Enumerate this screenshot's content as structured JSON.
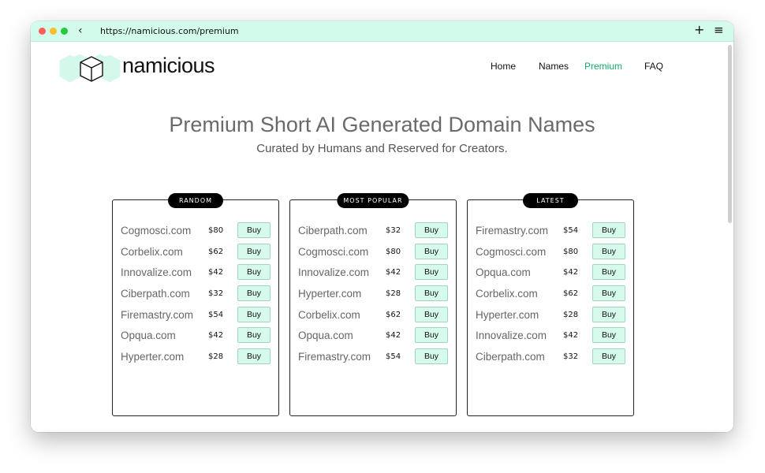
{
  "browser": {
    "url": "https://namicious.com/premium"
  },
  "site": {
    "brand": "namicious",
    "nav": [
      {
        "label": "Home"
      },
      {
        "label": "Names"
      },
      {
        "label": "Premium"
      },
      {
        "label": "FAQ"
      }
    ],
    "accent_color": "#19a86b",
    "button_color": "#d6fbec"
  },
  "hero": {
    "title": "Premium Short AI Generated Domain Names",
    "subtitle": "Curated by Humans and Reserved for Creators."
  },
  "cards": [
    {
      "label": "RANDOM",
      "items": [
        {
          "domain": "Cogmosci.com",
          "price": "$80",
          "action": "Buy"
        },
        {
          "domain": "Corbelix.com",
          "price": "$62",
          "action": "Buy"
        },
        {
          "domain": "Innovalize.com",
          "price": "$42",
          "action": "Buy"
        },
        {
          "domain": "Ciberpath.com",
          "price": "$32",
          "action": "Buy"
        },
        {
          "domain": "Firemastry.com",
          "price": "$54",
          "action": "Buy"
        },
        {
          "domain": "Opqua.com",
          "price": "$42",
          "action": "Buy"
        },
        {
          "domain": "Hyperter.com",
          "price": "$28",
          "action": "Buy"
        }
      ]
    },
    {
      "label": "MOST POPULAR",
      "items": [
        {
          "domain": "Ciberpath.com",
          "price": "$32",
          "action": "Buy"
        },
        {
          "domain": "Cogmosci.com",
          "price": "$80",
          "action": "Buy"
        },
        {
          "domain": "Innovalize.com",
          "price": "$42",
          "action": "Buy"
        },
        {
          "domain": "Hyperter.com",
          "price": "$28",
          "action": "Buy"
        },
        {
          "domain": "Corbelix.com",
          "price": "$62",
          "action": "Buy"
        },
        {
          "domain": "Opqua.com",
          "price": "$42",
          "action": "Buy"
        },
        {
          "domain": "Firemastry.com",
          "price": "$54",
          "action": "Buy"
        }
      ]
    },
    {
      "label": "LATEST",
      "items": [
        {
          "domain": "Firemastry.com",
          "price": "$54",
          "action": "Buy"
        },
        {
          "domain": "Cogmosci.com",
          "price": "$80",
          "action": "Buy"
        },
        {
          "domain": "Opqua.com",
          "price": "$42",
          "action": "Buy"
        },
        {
          "domain": "Corbelix.com",
          "price": "$62",
          "action": "Buy"
        },
        {
          "domain": "Hyperter.com",
          "price": "$28",
          "action": "Buy"
        },
        {
          "domain": "Innovalize.com",
          "price": "$42",
          "action": "Buy"
        },
        {
          "domain": "Ciberpath.com",
          "price": "$32",
          "action": "Buy"
        }
      ]
    }
  ]
}
